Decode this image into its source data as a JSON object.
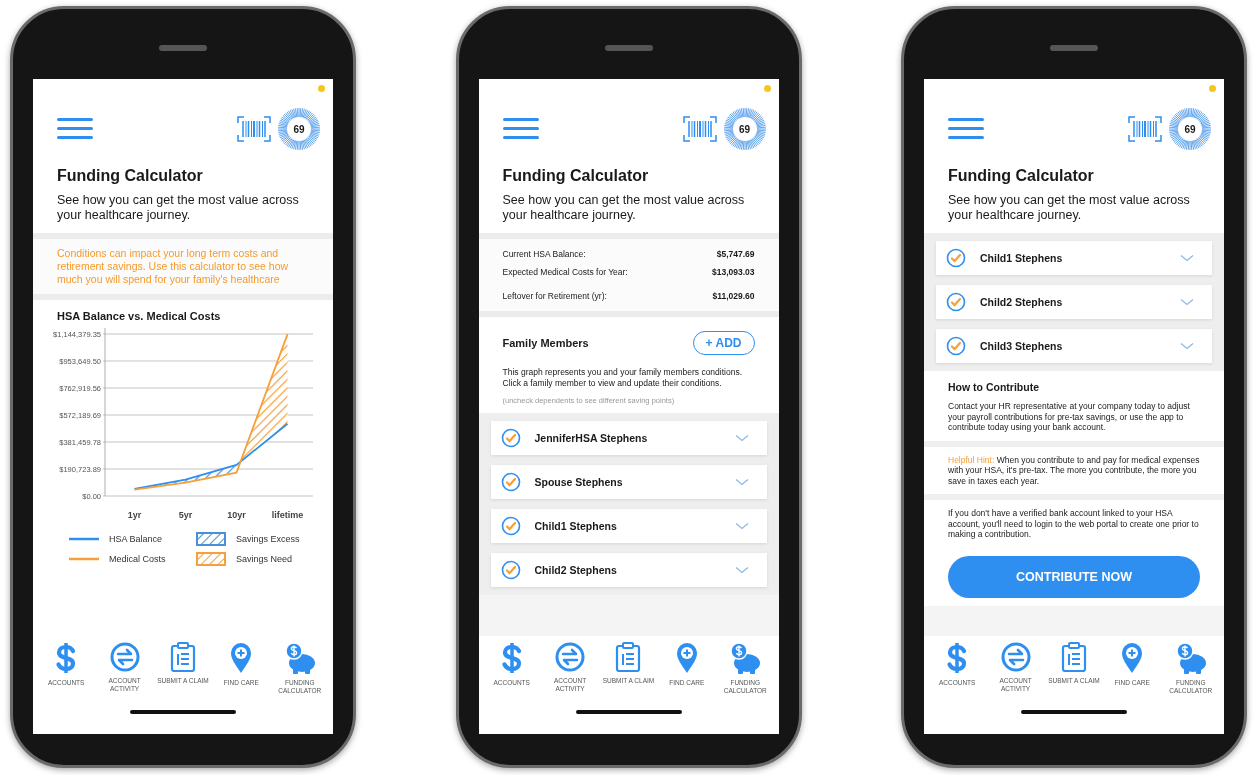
{
  "screens": [
    {
      "header": {
        "score": "69",
        "title": "Funding Calculator",
        "subtitle": "See how you can get the most value across your healthcare journey."
      },
      "sections": [
        {
          "kind": "notice",
          "text": "Conditions can impact your long term costs and retirement savings. Use this calculator to see how much you will spend for your family's healthcare"
        },
        {
          "kind": "chart",
          "title": "HSA Balance vs. Medical Costs",
          "chart_data": {
            "type": "line",
            "categories": [
              "1yr",
              "5yr",
              "10yr",
              "lifetime"
            ],
            "series": [
              {
                "name": "HSA Balance",
                "color": "#2e8ff0",
                "values": [
                  50000,
                  115000,
                  220000,
                  510000
                ]
              },
              {
                "name": "Medical Costs",
                "color": "#f5a03a",
                "values": [
                  45000,
                  95000,
                  165000,
                  1144000
                ]
              }
            ],
            "grid": true,
            "ylim": [
              0,
              1144379.35
            ],
            "yticks": [
              {
                "value": 0,
                "label": "$0.00"
              },
              {
                "value": 190723.89,
                "label": "$190,723.89"
              },
              {
                "value": 381459.78,
                "label": "$381,459.78"
              },
              {
                "value": 572189.69,
                "label": "$572,189.69"
              },
              {
                "value": 762919.56,
                "label": "$762,919.56"
              },
              {
                "value": 953649.5,
                "label": "$953,649.50"
              },
              {
                "value": 1144379.35,
                "label": "$1,144,379.35"
              }
            ]
          },
          "areas": [
            {
              "label": "Savings Excess",
              "color": "#4a90d9"
            },
            {
              "label": "Savings Need",
              "color": "#f5a03a"
            }
          ]
        }
      ],
      "tab_bar": [
        {
          "kind": "accounts",
          "label": "ACCOUNTS"
        },
        {
          "kind": "activity",
          "label": "ACCOUNT ACTIVITY"
        },
        {
          "kind": "claim",
          "label": "SUBMIT A CLAIM"
        },
        {
          "kind": "care",
          "label": "FIND CARE"
        },
        {
          "kind": "funding",
          "label": "FUNDING CALCULATOR"
        }
      ]
    },
    {
      "header": {
        "score": "69",
        "title": "Funding Calculator",
        "subtitle": "See how you can get the most value across your healthcare journey."
      },
      "sections": [
        {
          "kind": "summary",
          "rows": [
            {
              "label": "Current HSA Balance:",
              "value": "$5,747.69"
            },
            {
              "label": "Expected Medical Costs for Year:",
              "value": "$13,093.03"
            },
            {
              "label": "Leftover for Retirement (yr):",
              "value": "$11,029.60"
            }
          ]
        },
        {
          "kind": "family",
          "title": "Family Members",
          "add_button": "+ ADD",
          "description": "This graph represents you and your family members conditions. Click a family member to view and update their conditions.",
          "note": "(uncheck dependents to see different saving points)"
        },
        {
          "kind": "members",
          "members": [
            {
              "name": "JenniferHSA Stephens",
              "checked": true
            },
            {
              "name": "Spouse Stephens",
              "checked": true
            },
            {
              "name": "Child1 Stephens",
              "checked": true
            },
            {
              "name": "Child2 Stephens",
              "checked": true
            }
          ]
        }
      ],
      "tab_bar": [
        {
          "kind": "accounts",
          "label": "ACCOUNTS"
        },
        {
          "kind": "activity",
          "label": "ACCOUNT ACTIVITY"
        },
        {
          "kind": "claim",
          "label": "SUBMIT A CLAIM"
        },
        {
          "kind": "care",
          "label": "FIND CARE"
        },
        {
          "kind": "funding",
          "label": "FUNDING CALCULATOR"
        }
      ]
    },
    {
      "header": {
        "score": "69",
        "title": "Funding Calculator",
        "subtitle": "See how you can get the most value across your healthcare journey."
      },
      "sections": [
        {
          "kind": "members",
          "members": [
            {
              "name": "Child1 Stephens",
              "checked": true
            },
            {
              "name": "Child2 Stephens",
              "checked": true
            },
            {
              "name": "Child3 Stephens",
              "checked": true
            }
          ]
        },
        {
          "kind": "contribute",
          "title": "How to Contribute",
          "text": "Contact your HR representative at your company today to adjust your payroll contributions for pre-tax savings, or use the app to contribute today using your bank account."
        },
        {
          "kind": "hint",
          "label": "Helpful Hint:",
          "text": "When you contribute to and pay for medical expenses with your HSA, it's pre-tax. The more you contribute, the more you save in taxes each year."
        },
        {
          "kind": "info",
          "text": "If you don't have a verified bank account linked to your HSA account, you'll need to login to the web portal to create one prior to making a contribution."
        },
        {
          "kind": "button",
          "label": "CONTRIBUTE NOW"
        }
      ],
      "tab_bar": [
        {
          "kind": "accounts",
          "label": "ACCOUNTS"
        },
        {
          "kind": "activity",
          "label": "ACCOUNT ACTIVITY"
        },
        {
          "kind": "claim",
          "label": "SUBMIT A CLAIM"
        },
        {
          "kind": "care",
          "label": "FIND CARE"
        },
        {
          "kind": "funding",
          "label": "FUNDING CALCULATOR"
        }
      ]
    }
  ]
}
